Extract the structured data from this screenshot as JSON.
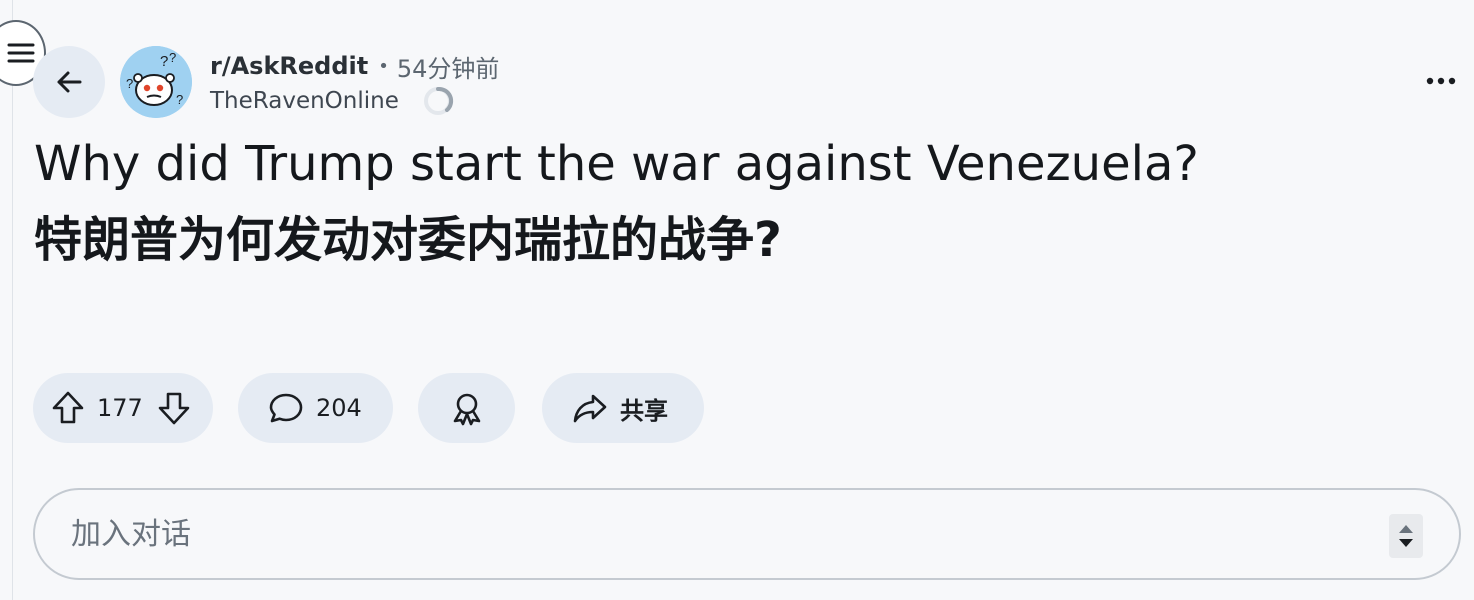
{
  "post": {
    "subreddit": "r/AskReddit",
    "separator": "•",
    "time": "54分钟前",
    "author": "TheRavenOnline",
    "title_en": "Why did Trump start the war against Venezuela?",
    "title_cn": "特朗普为何发动对委内瑞拉的战争?"
  },
  "actions": {
    "upvotes": "177",
    "comments": "204",
    "share_label": "共享"
  },
  "composer": {
    "placeholder": "加入对话"
  },
  "icons": {
    "menu": "hamburger-icon",
    "back": "arrow-left-icon",
    "avatar": "reddit-askreddit-avatar",
    "loading": "spinner-icon",
    "more": "more-horizontal-icon",
    "upvote": "arrow-up-icon",
    "downvote": "arrow-down-icon",
    "comment": "speech-bubble-icon",
    "award": "award-icon",
    "share": "share-arrow-icon"
  },
  "colors": {
    "background": "#f7f8fa",
    "pill": "#e5ebf3",
    "avatar_bg": "#9fd1f1",
    "text": "#1a1d21",
    "muted": "#5c6670"
  }
}
